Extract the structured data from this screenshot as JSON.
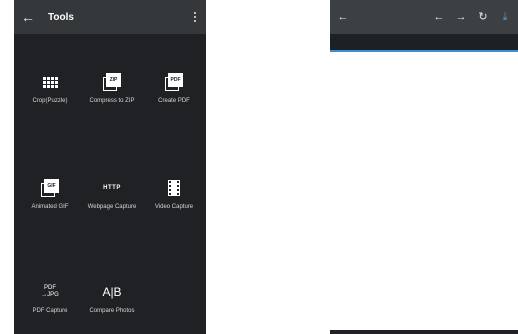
{
  "tools_screen": {
    "title": "Tools",
    "tools": [
      {
        "label": "Crop(Puzzle)",
        "icon": "grid-icon"
      },
      {
        "label": "Compress to ZIP",
        "icon": "zip-icon",
        "badge": "ZIP"
      },
      {
        "label": "Create PDF",
        "icon": "pdf-icon",
        "badge": "PDF"
      },
      {
        "label": "Animated GIF",
        "icon": "gif-icon",
        "badge": "GIF"
      },
      {
        "label": "Webpage Capture",
        "icon": "http-icon",
        "badge": "HTTP"
      },
      {
        "label": "Video Capture",
        "icon": "film-icon"
      },
      {
        "label": "PDF Capture",
        "icon": "pdf-to-jpg-icon",
        "badge_line1": "PDF",
        "badge_line2": "→JPG"
      },
      {
        "label": "Compare Photos",
        "icon": "compare-icon",
        "badge": "A|B"
      }
    ]
  },
  "browser_screen": {
    "accent_color": "#3a8fd6"
  },
  "colors": {
    "dark_bg": "#202124",
    "appbar": "#34383a",
    "progress": "#3a8fd6"
  }
}
